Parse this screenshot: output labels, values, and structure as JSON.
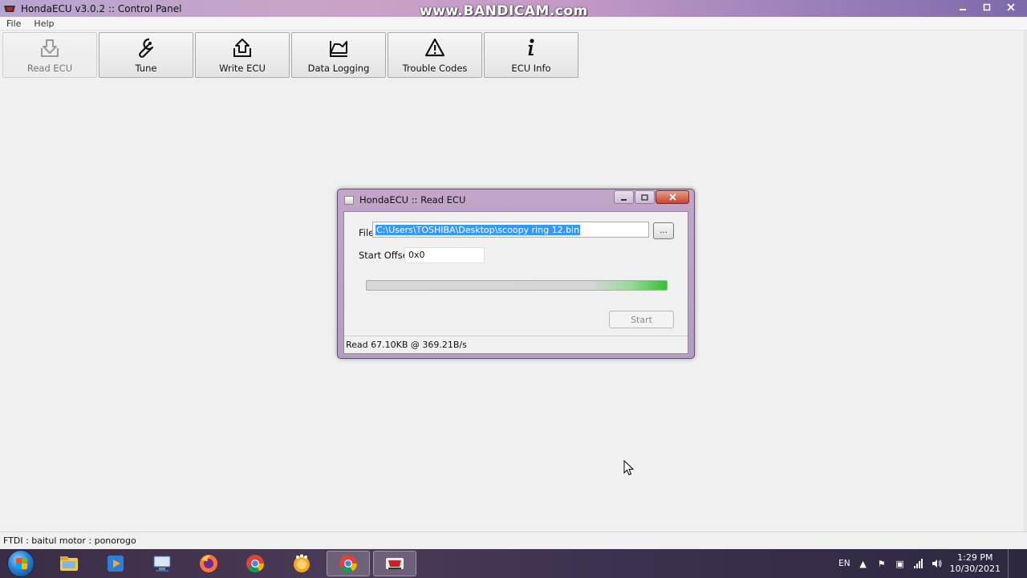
{
  "window": {
    "title": "HondaECU v3.0.2 :: Control Panel",
    "watermark": "www.BANDICAM.com",
    "controls": [
      "minimize-icon",
      "maximize-icon",
      "close-icon"
    ]
  },
  "menu": {
    "items": [
      {
        "label": "File"
      },
      {
        "label": "Help"
      }
    ]
  },
  "toolbar": {
    "buttons": [
      {
        "label": "Read ECU",
        "icon": "read-ecu-icon",
        "disabled": true
      },
      {
        "label": "Tune",
        "icon": "wrench-icon"
      },
      {
        "label": "Write ECU",
        "icon": "write-ecu-icon"
      },
      {
        "label": "Data Logging",
        "icon": "graph-icon"
      },
      {
        "label": "Trouble Codes",
        "icon": "warning-icon"
      },
      {
        "label": "ECU Info",
        "icon": "info-icon"
      }
    ]
  },
  "dialog": {
    "title": "HondaECU :: Read ECU",
    "file_label": "File",
    "file_value": "C:\\Users\\TOSHIBA\\Desktop\\scoopy ring 12.bin",
    "browse_label": "...",
    "offset_label": "Start Offset",
    "offset_value": "0x0",
    "progress_fraction": 1.0,
    "start_label": "Start",
    "status": "Read 67.10KB @ 369.21B/s"
  },
  "statusbar": {
    "text": "FTDI : baitul motor : ponorogo"
  },
  "taskbar": {
    "apps": [
      {
        "icon": "file-explorer-icon"
      },
      {
        "icon": "media-player-icon"
      },
      {
        "icon": "network-computer-icon"
      },
      {
        "icon": "firefox-icon"
      },
      {
        "icon": "chrome-icon"
      },
      {
        "icon": "orange-app-icon"
      },
      {
        "icon": "chrome-running-icon",
        "active": true
      },
      {
        "icon": "hondaecu-icon",
        "active": true
      }
    ],
    "language": "EN",
    "time": "1:29 PM",
    "date": "10/30/2021"
  },
  "colors": {
    "titlebar_accent": "#c9a4c9",
    "selection": "#3399ff",
    "progress_green": "#35c135"
  }
}
